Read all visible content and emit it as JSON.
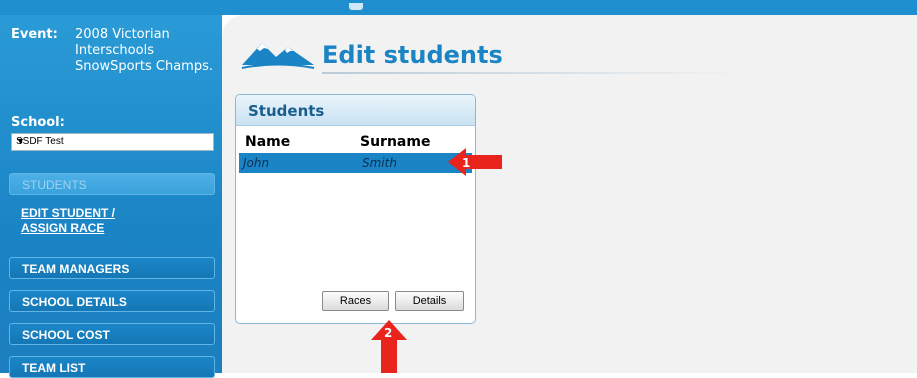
{
  "sidebar": {
    "event_label": "Event:",
    "event_value": "2008 Victorian Interschools SnowSports Champs.",
    "school_label": "School:",
    "school_selected": "SSDF Test",
    "nav": [
      {
        "label": "STUDENTS"
      },
      {
        "label": "EDIT STUDENT / ASSIGN RACE"
      },
      {
        "label": "TEAM MANAGERS"
      },
      {
        "label": "SCHOOL DETAILS"
      },
      {
        "label": "SCHOOL COST"
      },
      {
        "label": "TEAM LIST"
      }
    ]
  },
  "main": {
    "page_title": "Edit students",
    "panel": {
      "title": "Students",
      "columns": [
        "Name",
        "Surname"
      ],
      "rows": [
        {
          "name": "John",
          "surname": "Smith"
        }
      ],
      "buttons": {
        "races": "Races",
        "details": "Details"
      }
    }
  },
  "annotations": {
    "arrow1": "1",
    "arrow2": "2",
    "color": "#e8241c"
  },
  "colors": {
    "accent": "#1b84c4",
    "sidebar": "#1f8fd0",
    "selected_row": "#1b84c4"
  }
}
